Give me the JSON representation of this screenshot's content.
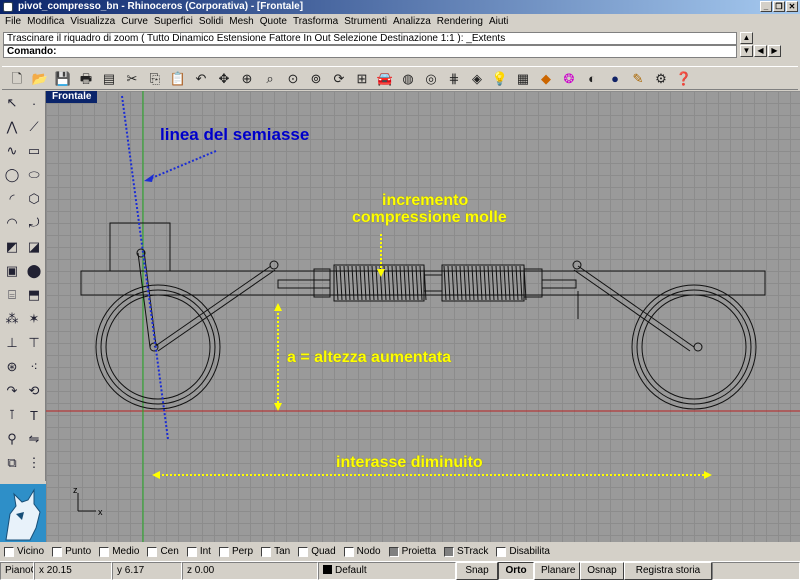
{
  "window": {
    "title": "pivot_compresso_bn - Rhinoceros (Corporativa) - [Frontale]",
    "controls": [
      "_",
      "❐",
      "✕"
    ]
  },
  "menu": [
    "File",
    "Modifica",
    "Visualizza",
    "Curve",
    "Superfici",
    "Solidi",
    "Mesh",
    "Quote",
    "Trasforma",
    "Strumenti",
    "Analizza",
    "Rendering",
    "Aiuti"
  ],
  "command": {
    "history": "Trascinare il riquadro di zoom ( Tutto  Dinamico  Estensione  Fattore  In  Out  Selezione  Destinazione  1:1 ): _Extents",
    "prompt": "Comando:",
    "value": ""
  },
  "toolbar": {
    "icons": [
      "new-icon",
      "open-icon",
      "save-icon",
      "print-icon",
      "import-icon",
      "cut-icon",
      "copy-icon",
      "paste-icon",
      "undo-icon",
      "pan-icon",
      "zoom-in-icon",
      "zoom-window-icon",
      "zoom-extents-icon",
      "zoom-selected-icon",
      "rotate-view-icon",
      "viewports-icon",
      "car-icon",
      "named-view-icon",
      "camera-icon",
      "grid-snap-icon",
      "layer-icon",
      "light-icon",
      "properties-icon",
      "shade-icon",
      "color-wheel-icon",
      "rendered-sphere-icon",
      "render-icon",
      "lamp-icon",
      "options-gear-icon",
      "help-icon"
    ]
  },
  "viewport": {
    "name": "Frontale"
  },
  "annotations": {
    "semiasse": "linea del semiasse",
    "incremento_line1": "incremento",
    "incremento_line2": "compressione molle",
    "altezza": "a = altezza aumentata",
    "interasse": "interasse diminuito"
  },
  "axes": {
    "x": "x",
    "z": "z"
  },
  "osnap": [
    {
      "label": "Vicino",
      "checked": false
    },
    {
      "label": "Punto",
      "checked": false
    },
    {
      "label": "Medio",
      "checked": false
    },
    {
      "label": "Cen",
      "checked": false
    },
    {
      "label": "Int",
      "checked": false
    },
    {
      "label": "Perp",
      "checked": false
    },
    {
      "label": "Tan",
      "checked": false
    },
    {
      "label": "Quad",
      "checked": false
    },
    {
      "label": "Nodo",
      "checked": false
    },
    {
      "label": "Proietta",
      "checked": true
    },
    {
      "label": "STrack",
      "checked": true
    },
    {
      "label": "Disabilita",
      "checked": false
    }
  ],
  "status": {
    "cplane": "PianoC",
    "x": "x 20.15",
    "y": "y 6.17",
    "z": "z 0.00",
    "layer": "Default",
    "snap": "Snap",
    "orto": "Orto",
    "planare": "Planare",
    "osnap": "Osnap",
    "history": "Registra storia"
  }
}
